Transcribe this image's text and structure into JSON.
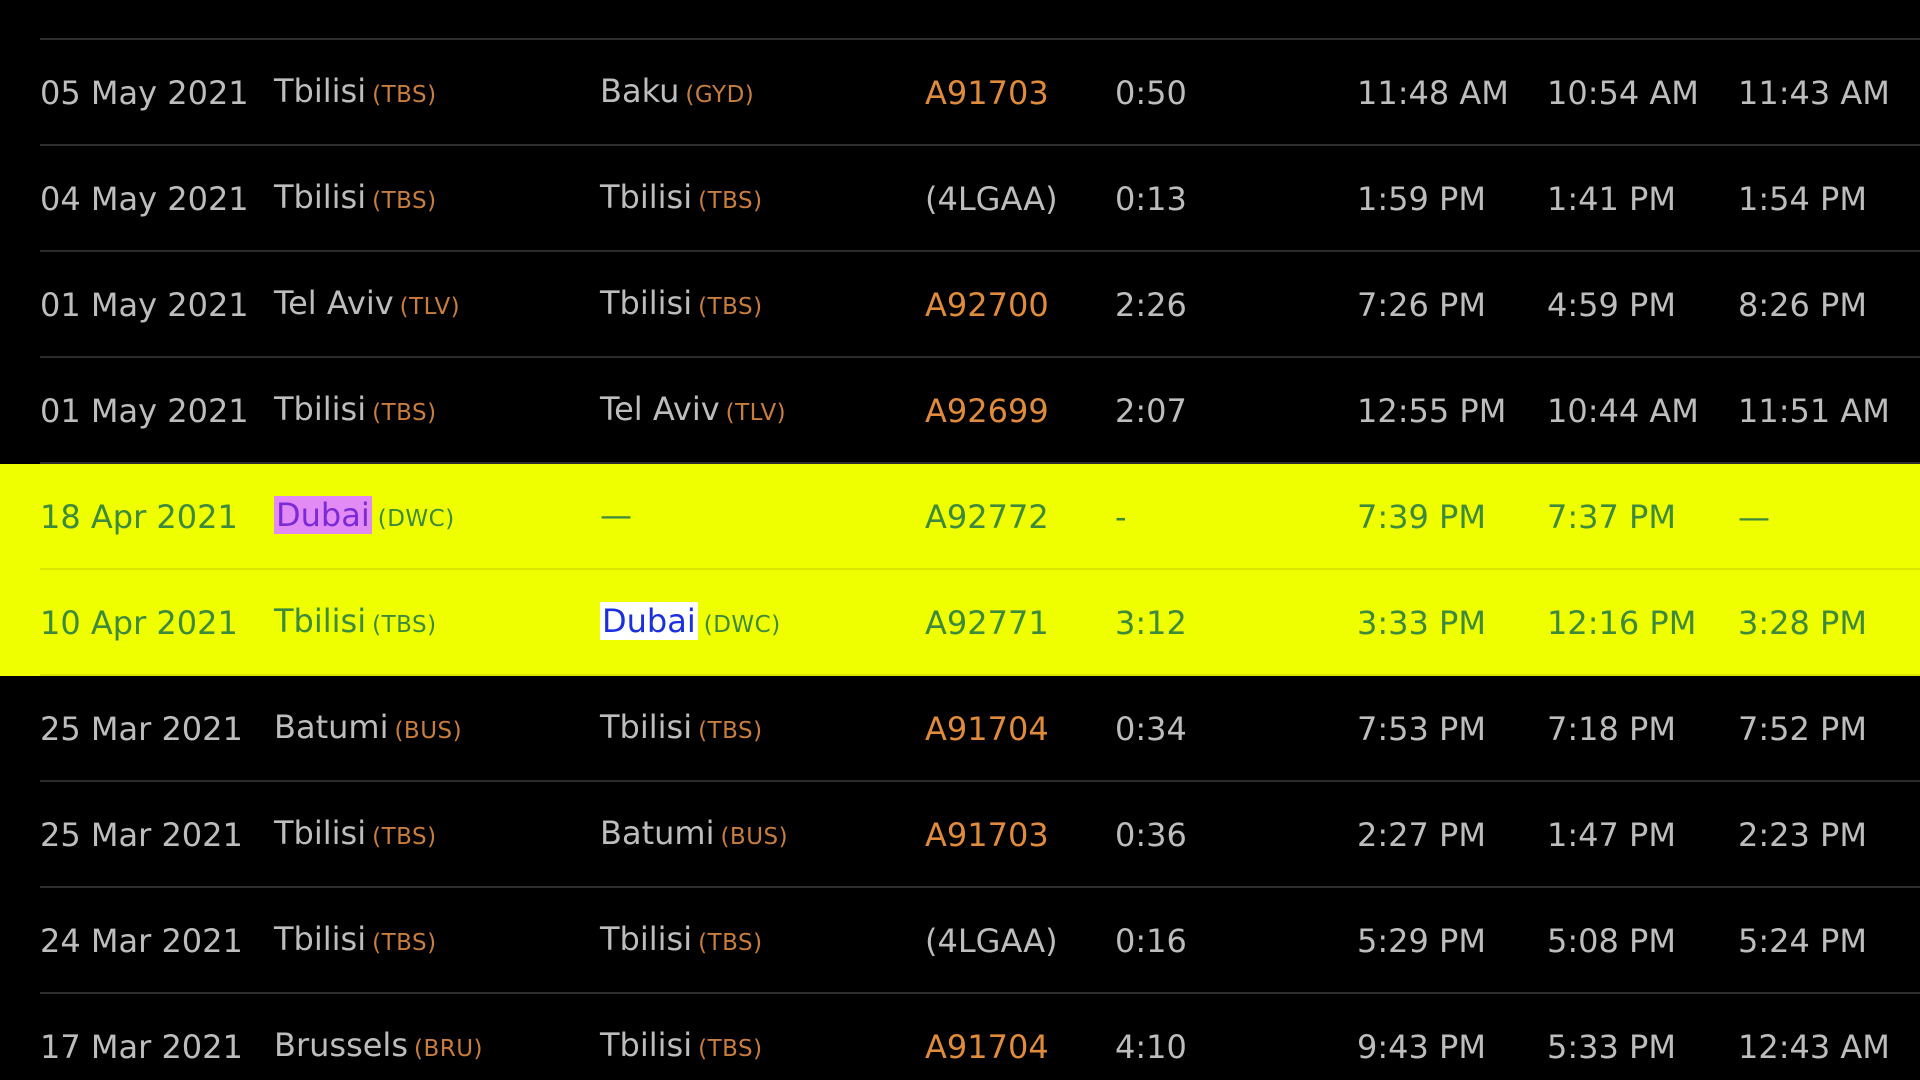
{
  "colors": {
    "background": "#000000",
    "text": "#bdbdbd",
    "airport_code": "#c87d3c",
    "flight_link": "#e08a3c",
    "highlight_row": "#f0ff00",
    "highlight_text": "#3d8a3d"
  },
  "rows": [
    {
      "date": "",
      "from_city": "",
      "from_code": "",
      "to_city": "",
      "to_code": "",
      "flight": "",
      "flight_link": false,
      "duration": "",
      "std": "",
      "atd": "",
      "sta": "",
      "highlight": false
    },
    {
      "date": "05 May 2021",
      "from_city": "Tbilisi",
      "from_code": "(TBS)",
      "to_city": "Baku",
      "to_code": "(GYD)",
      "flight": "A91703",
      "flight_link": true,
      "duration": "0:50",
      "std": "11:48 AM",
      "atd": "10:54 AM",
      "sta": "11:43 AM",
      "highlight": false
    },
    {
      "date": "04 May 2021",
      "from_city": "Tbilisi",
      "from_code": "(TBS)",
      "to_city": "Tbilisi",
      "to_code": "(TBS)",
      "flight": "(4LGAA)",
      "flight_link": false,
      "duration": "0:13",
      "std": "1:59 PM",
      "atd": "1:41 PM",
      "sta": "1:54 PM",
      "highlight": false
    },
    {
      "date": "01 May 2021",
      "from_city": "Tel Aviv",
      "from_code": "(TLV)",
      "to_city": "Tbilisi",
      "to_code": "(TBS)",
      "flight": "A92700",
      "flight_link": true,
      "duration": "2:26",
      "std": "7:26 PM",
      "atd": "4:59 PM",
      "sta": "8:26 PM",
      "highlight": false
    },
    {
      "date": "01 May 2021",
      "from_city": "Tbilisi",
      "from_code": "(TBS)",
      "to_city": "Tel Aviv",
      "to_code": "(TLV)",
      "flight": "A92699",
      "flight_link": true,
      "duration": "2:07",
      "std": "12:55 PM",
      "atd": "10:44 AM",
      "sta": "11:51 AM",
      "highlight": false
    },
    {
      "date": "18 Apr 2021",
      "from_city": "Dubai",
      "from_code": "(DWC)",
      "from_mark": "pink",
      "to_city": "—",
      "to_code": "",
      "flight": "A92772",
      "flight_link": true,
      "duration": "-",
      "std": "7:39 PM",
      "atd": "7:37 PM",
      "sta": "—",
      "highlight": true
    },
    {
      "date": "10 Apr 2021",
      "from_city": "Tbilisi",
      "from_code": "(TBS)",
      "to_city": "Dubai",
      "to_code": "(DWC)",
      "to_mark": "blue",
      "flight": "A92771",
      "flight_link": true,
      "duration": "3:12",
      "std": "3:33 PM",
      "atd": "12:16 PM",
      "sta": "3:28 PM",
      "highlight": true
    },
    {
      "date": "25 Mar 2021",
      "from_city": "Batumi",
      "from_code": "(BUS)",
      "to_city": "Tbilisi",
      "to_code": "(TBS)",
      "flight": "A91704",
      "flight_link": true,
      "duration": "0:34",
      "std": "7:53 PM",
      "atd": "7:18 PM",
      "sta": "7:52 PM",
      "highlight": false
    },
    {
      "date": "25 Mar 2021",
      "from_city": "Tbilisi",
      "from_code": "(TBS)",
      "to_city": "Batumi",
      "to_code": "(BUS)",
      "flight": "A91703",
      "flight_link": true,
      "duration": "0:36",
      "std": "2:27 PM",
      "atd": "1:47 PM",
      "sta": "2:23 PM",
      "highlight": false
    },
    {
      "date": "24 Mar 2021",
      "from_city": "Tbilisi",
      "from_code": "(TBS)",
      "to_city": "Tbilisi",
      "to_code": "(TBS)",
      "flight": "(4LGAA)",
      "flight_link": false,
      "duration": "0:16",
      "std": "5:29 PM",
      "atd": "5:08 PM",
      "sta": "5:24 PM",
      "highlight": false
    },
    {
      "date": "17 Mar 2021",
      "from_city": "Brussels",
      "from_code": "(BRU)",
      "to_city": "Tbilisi",
      "to_code": "(TBS)",
      "flight": "A91704",
      "flight_link": true,
      "duration": "4:10",
      "std": "9:43 PM",
      "atd": "5:33 PM",
      "sta": "12:43 AM",
      "highlight": false
    }
  ]
}
